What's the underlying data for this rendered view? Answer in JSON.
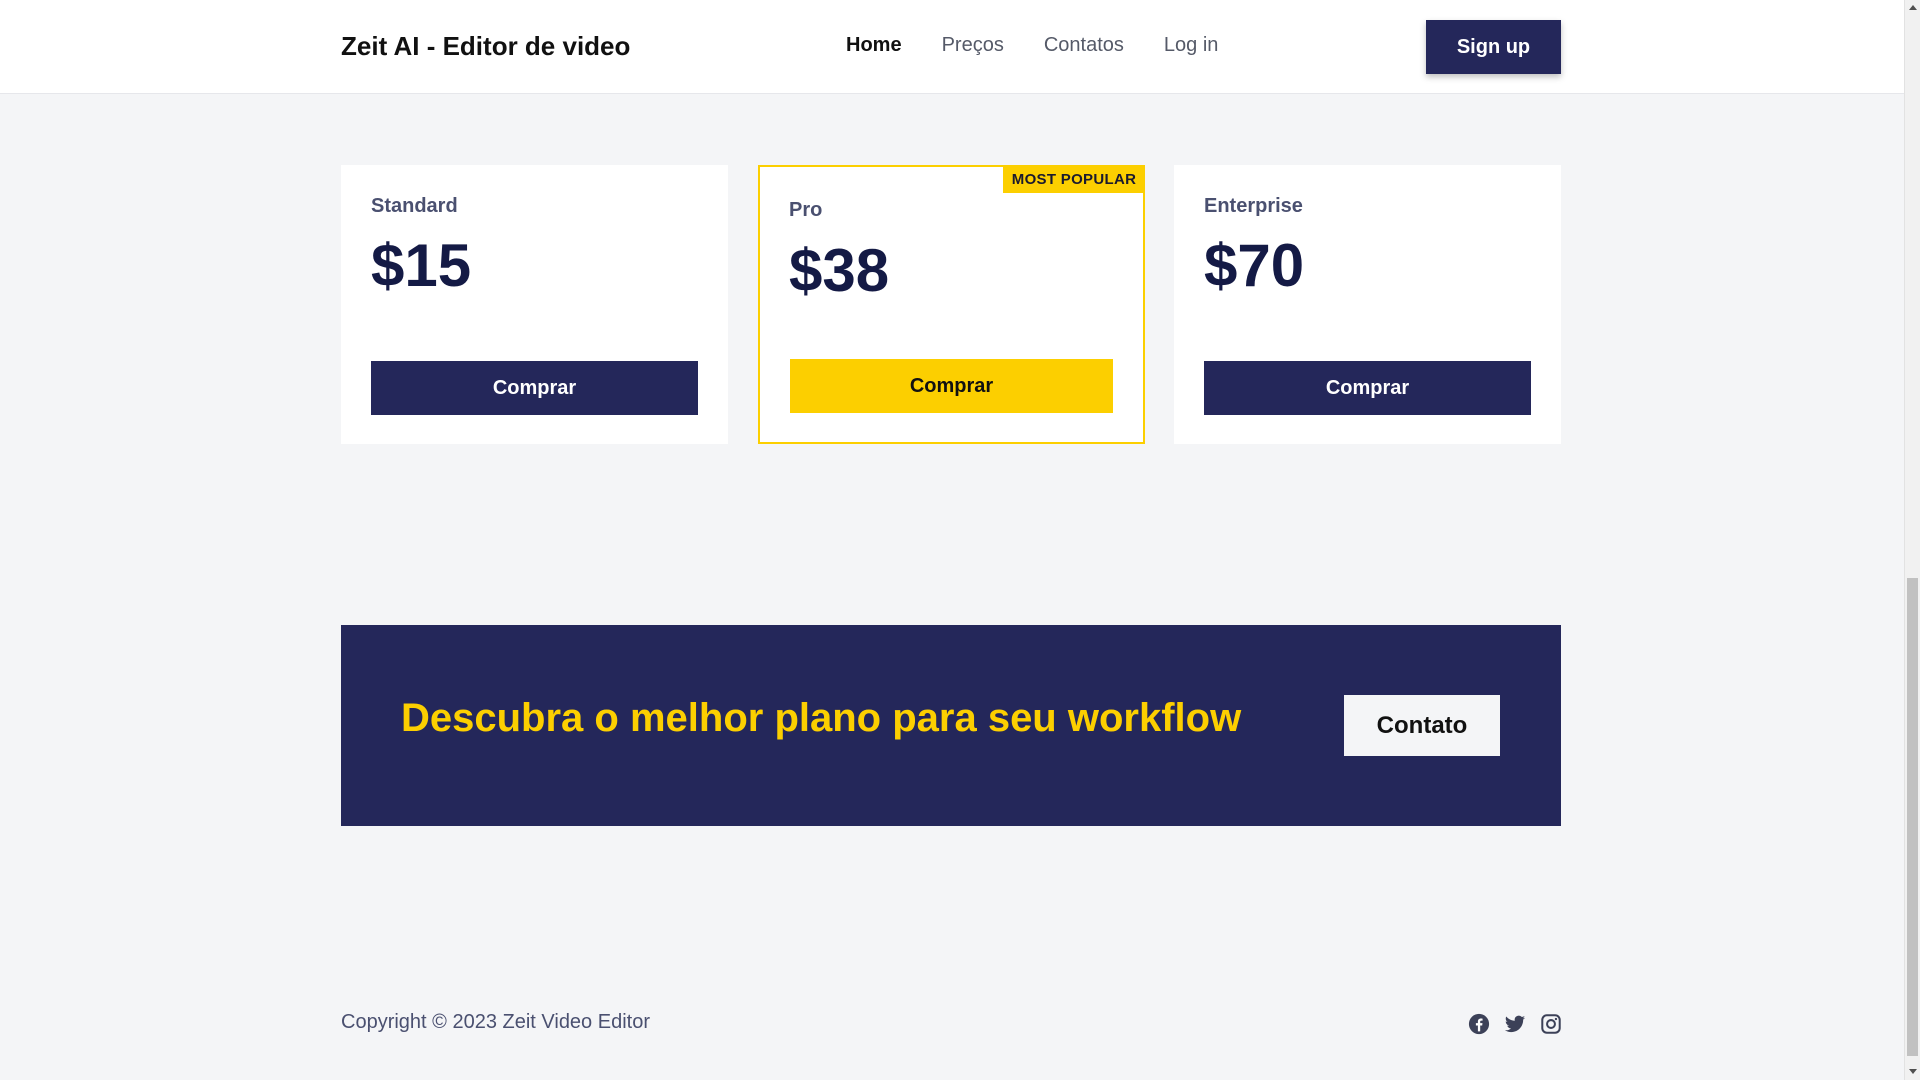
{
  "nav": {
    "brand": "Zeit AI - Editor de video",
    "links": [
      {
        "label": "Home",
        "active": true
      },
      {
        "label": "Preços",
        "active": false
      },
      {
        "label": "Contatos",
        "active": false
      },
      {
        "label": "Log in",
        "active": false
      }
    ],
    "signup_label": "Sign up"
  },
  "pricing": {
    "plans": [
      {
        "name": "Standard",
        "price": "$15",
        "button": "Comprar"
      },
      {
        "name": "Pro",
        "price": "$38",
        "button": "Comprar",
        "badge": "MOST POPULAR"
      },
      {
        "name": "Enterprise",
        "price": "$70",
        "button": "Comprar"
      }
    ]
  },
  "cta": {
    "text": "Descubra o melhor plano para seu workflow",
    "button": "Contato"
  },
  "footer": {
    "copyright": "Copyright © 2023 Zeit Video Editor",
    "socials": [
      "facebook-icon",
      "twitter-icon",
      "instagram-icon"
    ]
  },
  "colors": {
    "navy": "#24275a",
    "yellow": "#fccf00",
    "background": "#f4f5f7"
  }
}
